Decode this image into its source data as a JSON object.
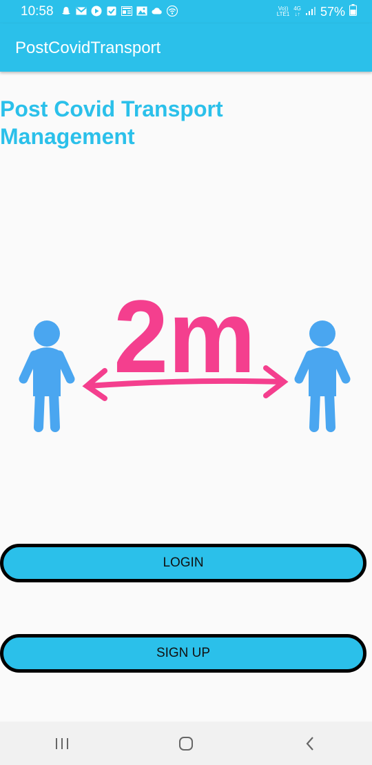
{
  "status_bar": {
    "time": "10:58",
    "network_top": "Vo))",
    "network_bottom": "LTE1",
    "data_type": "4G",
    "battery": "57%",
    "notification_icons": [
      "snapchat-icon",
      "gmail-icon",
      "play-icon",
      "check-icon",
      "news-icon",
      "gallery-icon",
      "cloud-icon",
      "wifi-icon"
    ]
  },
  "app_bar": {
    "title": "PostCovidTransport"
  },
  "main": {
    "headline": "Post Covid Transport Management",
    "illustration": {
      "distance_label": "2m"
    }
  },
  "buttons": {
    "login": "LOGIN",
    "signup": "SIGN UP"
  },
  "colors": {
    "primary": "#2bc0ea",
    "accent_pink": "#f43f8e",
    "figure_blue": "#4aa6f0"
  },
  "nav_bar": {
    "items": [
      "recents-icon",
      "home-icon",
      "back-icon"
    ]
  }
}
